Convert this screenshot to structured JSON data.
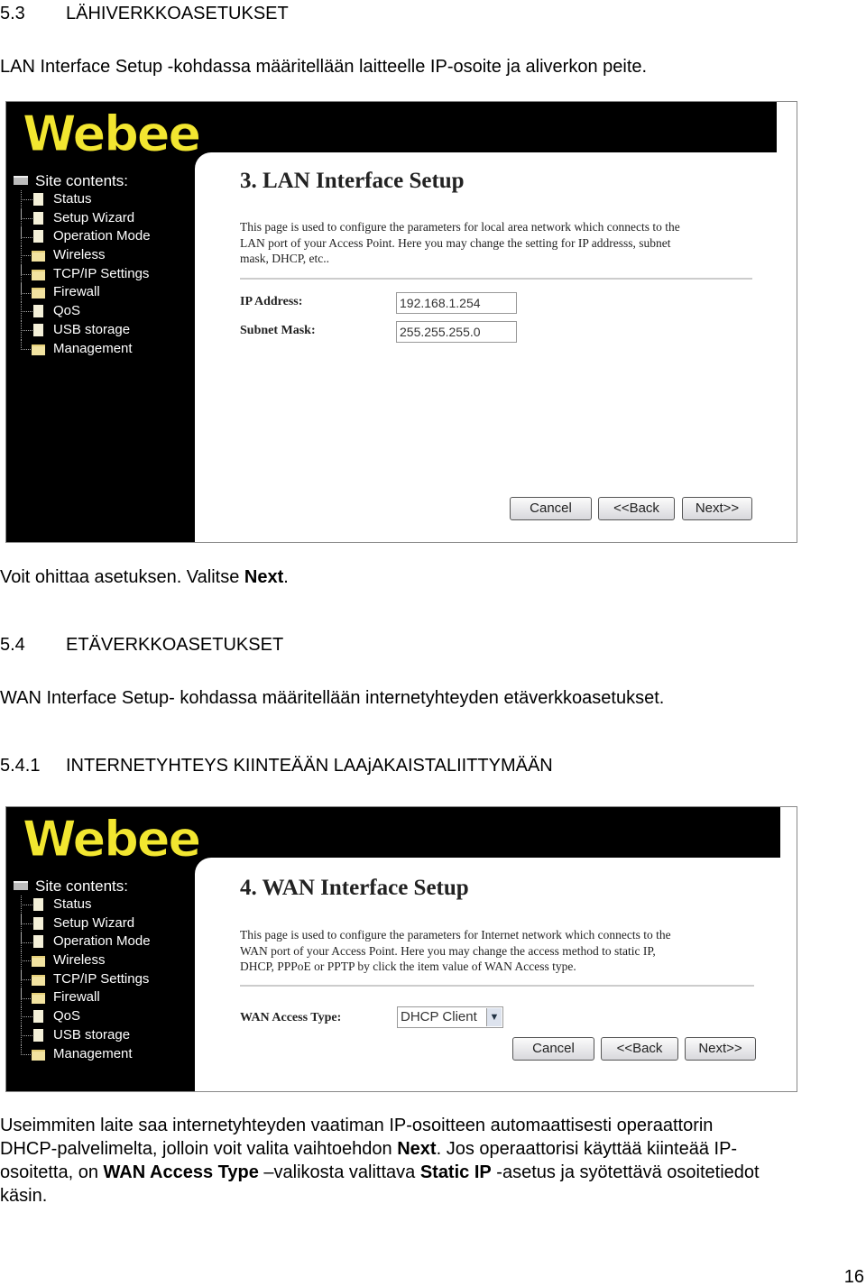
{
  "section_53": {
    "number": "5.3",
    "title": "LÄHIVERKKOASETUKSET",
    "intro": "LAN Interface Setup -kohdassa määritellään laitteelle IP-osoite ja aliverkon peite."
  },
  "router_ui": {
    "logo": "Webee",
    "nav_header": "Site contents:",
    "nav_items": [
      {
        "label": "Status",
        "icon": "page-icon"
      },
      {
        "label": "Setup Wizard",
        "icon": "page-icon"
      },
      {
        "label": "Operation Mode",
        "icon": "page-icon"
      },
      {
        "label": "Wireless",
        "icon": "folder-icon"
      },
      {
        "label": "TCP/IP Settings",
        "icon": "folder-icon"
      },
      {
        "label": "Firewall",
        "icon": "folder-icon"
      },
      {
        "label": "QoS",
        "icon": "page-icon"
      },
      {
        "label": "USB storage",
        "icon": "page-icon"
      },
      {
        "label": "Management",
        "icon": "folder-icon"
      }
    ],
    "buttons": {
      "cancel": "Cancel",
      "back": "<<Back",
      "next": "Next>>"
    },
    "logo_color": "#f2e630"
  },
  "lan_screen": {
    "title": "3. LAN Interface Setup",
    "description": [
      "This page is used to configure the parameters for local area network which connects to the",
      "LAN port of your Access Point. Here you may change the setting for IP addresss, subnet",
      "mask, DHCP, etc.."
    ],
    "ip_label": "IP Address:",
    "ip_value": "192.168.1.254",
    "mask_label": "Subnet Mask:",
    "mask_value": "255.255.255.0"
  },
  "after_lan": {
    "text": "Voit ohittaa asetuksen. Valitse ",
    "bold": "Next",
    "end": "."
  },
  "section_54": {
    "number": "5.4",
    "title": "ETÄVERKKOASETUKSET",
    "intro": "WAN Interface Setup- kohdassa määritellään internetyhteyden etäverkkoasetukset."
  },
  "section_541": {
    "number": "5.4.1",
    "title": "INTERNETYHTEYS KIINTEÄÄN LAAjAKAISTALIITTYMÄÄN"
  },
  "wan_screen": {
    "title": "4. WAN Interface Setup",
    "description": [
      "This page is used to configure the parameters for Internet network which connects to the",
      "WAN port of your Access Point. Here you may change the access method to static IP,",
      "DHCP, PPPoE or PPTP by click the item value of WAN Access type."
    ],
    "access_label": "WAN Access Type:",
    "access_value": "DHCP Client"
  },
  "closing": {
    "p1": "Useimmiten laite saa internetyhteyden vaatiman IP-osoitteen automaattisesti operaattorin",
    "p2a": "DHCP-palvelimelta, jolloin voit valita vaihtoehdon ",
    "p2b": "Next",
    "p2c": ". Jos operaattorisi käyttää kiinteää IP-",
    "p3a": "osoitetta, on ",
    "p3b": "WAN Access Type",
    "p3c": " –valikosta valittava ",
    "p3d": "Static IP",
    "p3e": " -asetus ja syötettävä osoitetiedot",
    "p4": "käsin."
  },
  "page_number": "16"
}
